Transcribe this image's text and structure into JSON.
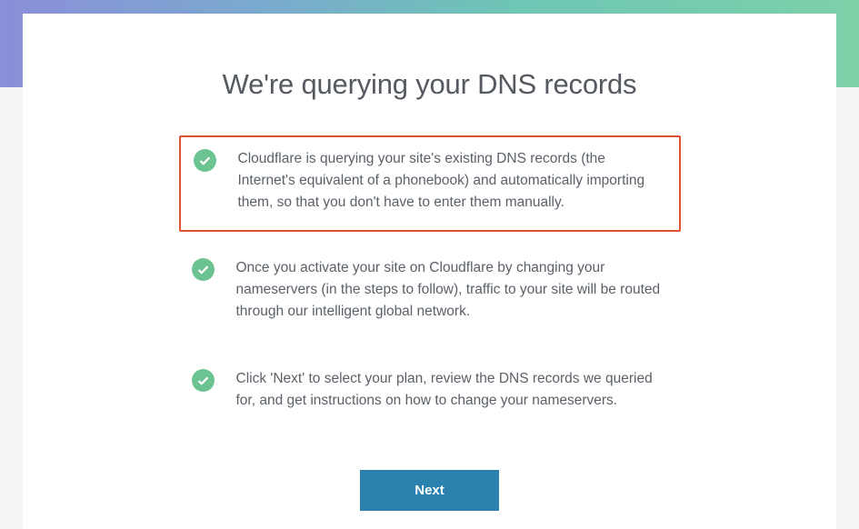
{
  "heading": "We're querying your DNS records",
  "steps": [
    {
      "text": "Cloudflare is querying your site's existing DNS records (the Internet's equivalent of a phonebook) and automatically importing them, so that you don't have to enter them manually.",
      "highlighted": true
    },
    {
      "text": "Once you activate your site on Cloudflare by changing your nameservers (in the steps to follow), traffic to your site will be routed through our intelligent global network.",
      "highlighted": false
    },
    {
      "text": "Click 'Next' to select your plan, review the DNS records we queried for, and get instructions on how to change your nameservers.",
      "highlighted": false
    }
  ],
  "button": {
    "next_label": "Next"
  },
  "colors": {
    "highlight_border": "#e0502f",
    "check_bg": "#6ac390",
    "button_bg": "#2b81ae"
  }
}
